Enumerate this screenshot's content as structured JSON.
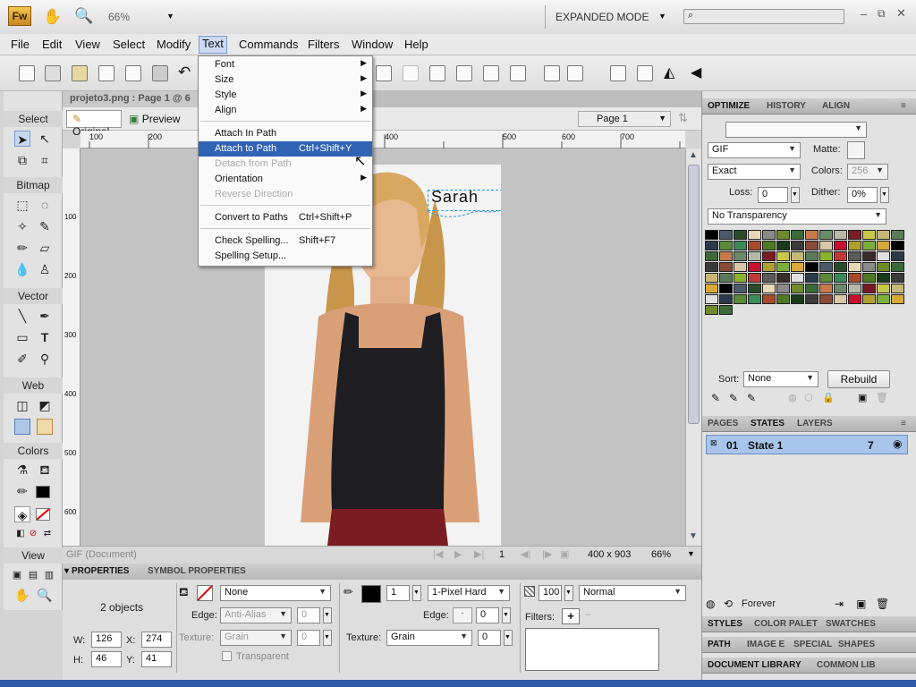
{
  "app": {
    "logo": "Fw",
    "zoom": "66%",
    "mode": "EXPANDED MODE"
  },
  "menubar": {
    "items": [
      "File",
      "Edit",
      "View",
      "Select",
      "Modify",
      "Text",
      "Commands",
      "Filters",
      "Window",
      "Help"
    ]
  },
  "document": {
    "tab": "projeto3.png : Page 1 @ 6",
    "view_tabs": [
      "Original",
      "Preview"
    ],
    "page_select": "Page 1",
    "ruler_h": [
      "100",
      "200",
      "300",
      "400",
      "500",
      "600",
      "700"
    ],
    "ruler_v": [
      "100",
      "200",
      "300",
      "400",
      "500",
      "600"
    ],
    "canvas_text": "Sarah"
  },
  "text_menu": {
    "items": [
      {
        "label": "Font",
        "sub": true
      },
      {
        "label": "Size",
        "sub": true
      },
      {
        "label": "Style",
        "sub": true
      },
      {
        "label": "Align",
        "sub": true
      },
      {
        "label": "Attach In Path"
      },
      {
        "label": "Attach to Path",
        "shortcut": "Ctrl+Shift+Y",
        "highlighted": true
      },
      {
        "label": "Detach from Path",
        "disabled": true
      },
      {
        "label": "Orientation",
        "sub": true
      },
      {
        "label": "Reverse Direction",
        "disabled": true
      },
      {
        "label": "Convert to Paths",
        "shortcut": "Ctrl+Shift+P"
      },
      {
        "label": "Check Spelling...",
        "shortcut": "Shift+F7"
      },
      {
        "label": "Spelling Setup..."
      }
    ]
  },
  "tools": {
    "select": "Select",
    "bitmap": "Bitmap",
    "vector": "Vector",
    "web": "Web",
    "colors": "Colors",
    "view": "View"
  },
  "status": {
    "format": "GIF (Document)",
    "page": "1",
    "size": "400 x 903",
    "zoom": "66%"
  },
  "properties": {
    "tabs": [
      "PROPERTIES",
      "SYMBOL PROPERTIES"
    ],
    "summary": "2 objects",
    "w_label": "W:",
    "w": "126",
    "x_label": "X:",
    "x": "274",
    "h_label": "H:",
    "h": "46",
    "y_label": "Y:",
    "y": "41",
    "fill": "None",
    "edge_label": "Edge:",
    "edge": "Anti-Alias",
    "edge_val": "0",
    "texture_label": "Texture:",
    "texture": "Grain",
    "texture_val": "0",
    "transparent": "Transparent",
    "stroke_size": "1",
    "stroke_type": "1-Pixel Hard",
    "stroke_edge_label": "Edge:",
    "stroke_edge": "0",
    "stroke_texture_label": "Texture:",
    "stroke_texture": "Grain",
    "stroke_texture_val": "0",
    "opacity": "100",
    "blend": "Normal",
    "filters_label": "Filters:"
  },
  "optimize": {
    "tabs": [
      "OPTIMIZE",
      "HISTORY",
      "ALIGN"
    ],
    "format": "GIF",
    "matte_label": "Matte:",
    "palette": "Exact",
    "colors_label": "Colors:",
    "colors": "256",
    "loss_label": "Loss:",
    "loss": "0",
    "dither_label": "Dither:",
    "dither": "0%",
    "transparency": "No Transparency",
    "sort_label": "Sort:",
    "sort": "None",
    "rebuild": "Rebuild",
    "swatch_colors": [
      "#000000",
      "#4e7a24",
      "#8ab32c",
      "#6e8a2a",
      "#c8102e",
      "#2a3a4a",
      "#7a1c24",
      "#4a5a6a",
      "#1a3a1a",
      "#c03a3a",
      "#3a6a3a",
      "#b0a030",
      "#5a8a3a",
      "#c8c848",
      "#2a4a2a",
      "#3a3a3a",
      "#5a5a5a",
      "#c87a4a",
      "#7ab03a",
      "#3a8a5a",
      "#c8b878",
      "#e8d8b8",
      "#8a4a3a",
      "#3a2a2a",
      "#6a8a6a",
      "#d8a838",
      "#a84a2a",
      "#5a7a5a",
      "#8a8a8a",
      "#d8c8a8",
      "#e0e0e0",
      "#b8b8a8"
    ]
  },
  "states": {
    "tabs": [
      "PAGES",
      "STATES",
      "LAYERS"
    ],
    "row_num": "01",
    "row_name": "State 1",
    "row_count": "7",
    "forever": "Forever"
  },
  "bottom_tabs": {
    "row1": [
      "STYLES",
      "COLOR PALET",
      "SWATCHES"
    ],
    "row2": [
      "PATH",
      "IMAGE E",
      "SPECIAL",
      "SHAPES"
    ],
    "row3": [
      "DOCUMENT LIBRARY",
      "COMMON LIB"
    ]
  }
}
